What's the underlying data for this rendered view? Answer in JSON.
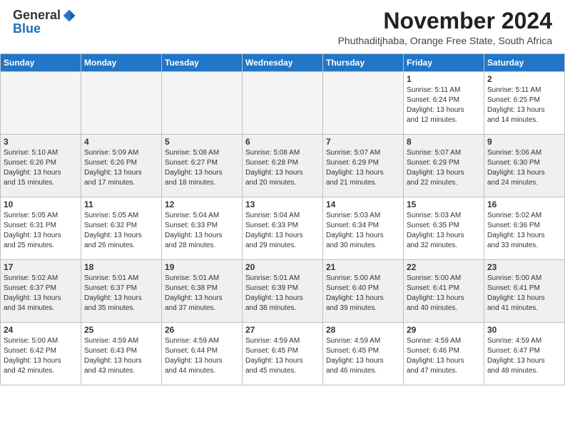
{
  "header": {
    "logo_general": "General",
    "logo_blue": "Blue",
    "month_title": "November 2024",
    "location": "Phuthaditjhaba, Orange Free State, South Africa"
  },
  "weekdays": [
    "Sunday",
    "Monday",
    "Tuesday",
    "Wednesday",
    "Thursday",
    "Friday",
    "Saturday"
  ],
  "weeks": [
    [
      {
        "day": "",
        "detail": ""
      },
      {
        "day": "",
        "detail": ""
      },
      {
        "day": "",
        "detail": ""
      },
      {
        "day": "",
        "detail": ""
      },
      {
        "day": "",
        "detail": ""
      },
      {
        "day": "1",
        "detail": "Sunrise: 5:11 AM\nSunset: 6:24 PM\nDaylight: 13 hours\nand 12 minutes."
      },
      {
        "day": "2",
        "detail": "Sunrise: 5:11 AM\nSunset: 6:25 PM\nDaylight: 13 hours\nand 14 minutes."
      }
    ],
    [
      {
        "day": "3",
        "detail": "Sunrise: 5:10 AM\nSunset: 6:26 PM\nDaylight: 13 hours\nand 15 minutes."
      },
      {
        "day": "4",
        "detail": "Sunrise: 5:09 AM\nSunset: 6:26 PM\nDaylight: 13 hours\nand 17 minutes."
      },
      {
        "day": "5",
        "detail": "Sunrise: 5:08 AM\nSunset: 6:27 PM\nDaylight: 13 hours\nand 18 minutes."
      },
      {
        "day": "6",
        "detail": "Sunrise: 5:08 AM\nSunset: 6:28 PM\nDaylight: 13 hours\nand 20 minutes."
      },
      {
        "day": "7",
        "detail": "Sunrise: 5:07 AM\nSunset: 6:29 PM\nDaylight: 13 hours\nand 21 minutes."
      },
      {
        "day": "8",
        "detail": "Sunrise: 5:07 AM\nSunset: 6:29 PM\nDaylight: 13 hours\nand 22 minutes."
      },
      {
        "day": "9",
        "detail": "Sunrise: 5:06 AM\nSunset: 6:30 PM\nDaylight: 13 hours\nand 24 minutes."
      }
    ],
    [
      {
        "day": "10",
        "detail": "Sunrise: 5:05 AM\nSunset: 6:31 PM\nDaylight: 13 hours\nand 25 minutes."
      },
      {
        "day": "11",
        "detail": "Sunrise: 5:05 AM\nSunset: 6:32 PM\nDaylight: 13 hours\nand 26 minutes."
      },
      {
        "day": "12",
        "detail": "Sunrise: 5:04 AM\nSunset: 6:33 PM\nDaylight: 13 hours\nand 28 minutes."
      },
      {
        "day": "13",
        "detail": "Sunrise: 5:04 AM\nSunset: 6:33 PM\nDaylight: 13 hours\nand 29 minutes."
      },
      {
        "day": "14",
        "detail": "Sunrise: 5:03 AM\nSunset: 6:34 PM\nDaylight: 13 hours\nand 30 minutes."
      },
      {
        "day": "15",
        "detail": "Sunrise: 5:03 AM\nSunset: 6:35 PM\nDaylight: 13 hours\nand 32 minutes."
      },
      {
        "day": "16",
        "detail": "Sunrise: 5:02 AM\nSunset: 6:36 PM\nDaylight: 13 hours\nand 33 minutes."
      }
    ],
    [
      {
        "day": "17",
        "detail": "Sunrise: 5:02 AM\nSunset: 6:37 PM\nDaylight: 13 hours\nand 34 minutes."
      },
      {
        "day": "18",
        "detail": "Sunrise: 5:01 AM\nSunset: 6:37 PM\nDaylight: 13 hours\nand 35 minutes."
      },
      {
        "day": "19",
        "detail": "Sunrise: 5:01 AM\nSunset: 6:38 PM\nDaylight: 13 hours\nand 37 minutes."
      },
      {
        "day": "20",
        "detail": "Sunrise: 5:01 AM\nSunset: 6:39 PM\nDaylight: 13 hours\nand 38 minutes."
      },
      {
        "day": "21",
        "detail": "Sunrise: 5:00 AM\nSunset: 6:40 PM\nDaylight: 13 hours\nand 39 minutes."
      },
      {
        "day": "22",
        "detail": "Sunrise: 5:00 AM\nSunset: 6:41 PM\nDaylight: 13 hours\nand 40 minutes."
      },
      {
        "day": "23",
        "detail": "Sunrise: 5:00 AM\nSunset: 6:41 PM\nDaylight: 13 hours\nand 41 minutes."
      }
    ],
    [
      {
        "day": "24",
        "detail": "Sunrise: 5:00 AM\nSunset: 6:42 PM\nDaylight: 13 hours\nand 42 minutes."
      },
      {
        "day": "25",
        "detail": "Sunrise: 4:59 AM\nSunset: 6:43 PM\nDaylight: 13 hours\nand 43 minutes."
      },
      {
        "day": "26",
        "detail": "Sunrise: 4:59 AM\nSunset: 6:44 PM\nDaylight: 13 hours\nand 44 minutes."
      },
      {
        "day": "27",
        "detail": "Sunrise: 4:59 AM\nSunset: 6:45 PM\nDaylight: 13 hours\nand 45 minutes."
      },
      {
        "day": "28",
        "detail": "Sunrise: 4:59 AM\nSunset: 6:45 PM\nDaylight: 13 hours\nand 46 minutes."
      },
      {
        "day": "29",
        "detail": "Sunrise: 4:59 AM\nSunset: 6:46 PM\nDaylight: 13 hours\nand 47 minutes."
      },
      {
        "day": "30",
        "detail": "Sunrise: 4:59 AM\nSunset: 6:47 PM\nDaylight: 13 hours\nand 48 minutes."
      }
    ]
  ]
}
